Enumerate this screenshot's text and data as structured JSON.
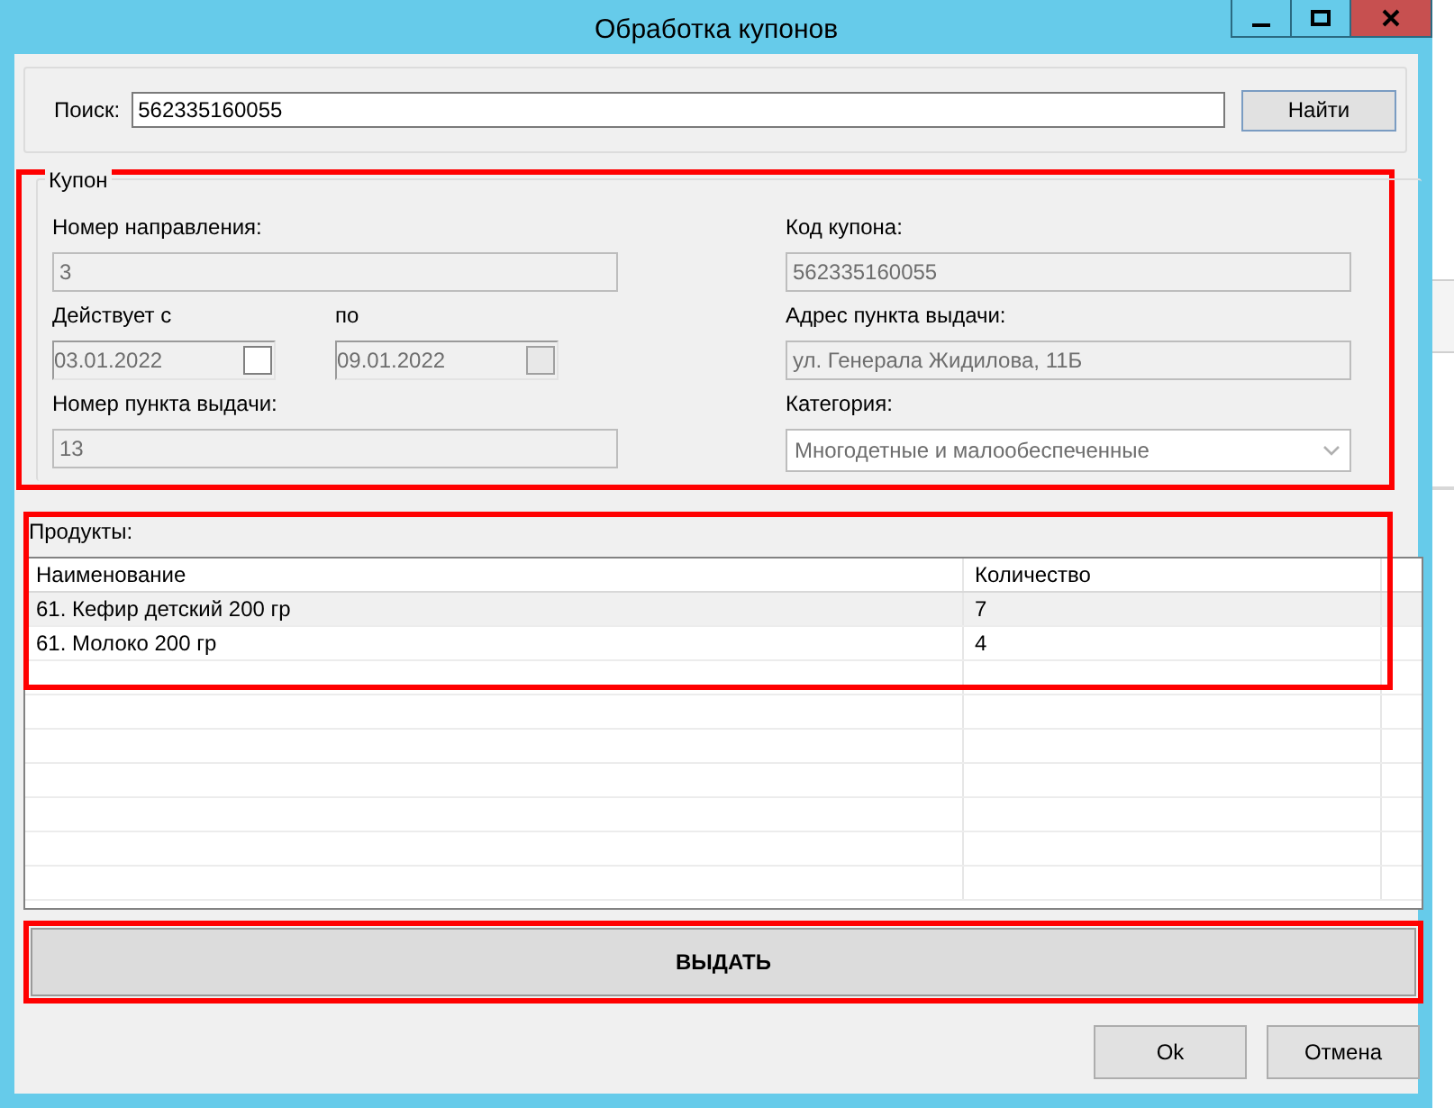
{
  "window": {
    "title": "Обработка купонов"
  },
  "search": {
    "label": "Поиск:",
    "value": "562335160055",
    "button": "Найти"
  },
  "coupon": {
    "title": "Купон",
    "direction_number": {
      "label": "Номер направления:",
      "value": "3"
    },
    "valid_from": {
      "label": "Действует с",
      "value": "03.01.2022",
      "checkbox_disabled": false
    },
    "valid_to": {
      "label": "по",
      "value": "09.01.2022",
      "checkbox_disabled": true
    },
    "pickup_point_number": {
      "label": "Номер пункта выдачи:",
      "value": "13"
    },
    "coupon_code": {
      "label": "Код купона:",
      "value": "562335160055"
    },
    "pickup_address": {
      "label": "Адрес пункта выдачи:",
      "value": "ул. Генерала Жидилова, 11Б"
    },
    "category": {
      "label": "Категория:",
      "value": "Многодетные и малообеспеченные"
    }
  },
  "products": {
    "label": "Продукты:",
    "columns": [
      "Наименование",
      "Количество"
    ],
    "rows": [
      {
        "name": "61. Кефир детский 200 гр",
        "quantity": "7",
        "selected": true
      },
      {
        "name": "61. Молоко 200 гр",
        "quantity": "4",
        "selected": false
      }
    ]
  },
  "issue_button": "ВЫДАТЬ",
  "buttons": [
    "Ok",
    "Отмена"
  ]
}
